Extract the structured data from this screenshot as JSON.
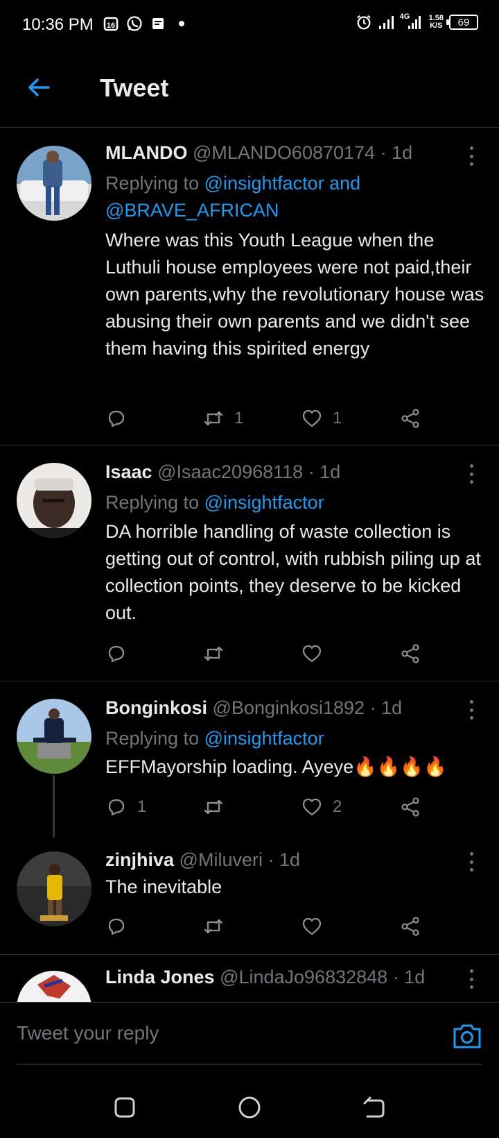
{
  "status_bar": {
    "time": "10:36 PM",
    "network_type": "4G",
    "net_speed_value": "1.58",
    "net_speed_unit": "K/S",
    "battery": "69",
    "left_icons": [
      "calendar-icon",
      "whatsapp-icon",
      "message-icon",
      "dot-icon"
    ],
    "right_icons": [
      "alarm-icon",
      "signal-icon",
      "signal-4g-icon"
    ]
  },
  "header": {
    "title": "Tweet"
  },
  "tweets": [
    {
      "name": "MLANDO",
      "handle": "@MLANDO60870174",
      "time": "· 1d",
      "replying_prefix": "Replying to",
      "replying_mentions": "@insightfactor and @BRAVE_AFRICAN",
      "text": "Where was this Youth League when the Luthuli house employees were not paid,their own parents,why the revolutionary house was abusing their own parents and we didn't see them having this spirited energy",
      "replies": "",
      "retweets": "1",
      "likes": "1"
    },
    {
      "name": "Isaac",
      "handle": "@Isaac20968118",
      "time": "· 1d",
      "replying_prefix": "Replying to",
      "replying_mentions": "@insightfactor",
      "text": "DA horrible handling of waste collection is getting out of control, with rubbish piling up at collection points, they deserve to be kicked out.",
      "replies": "",
      "retweets": "",
      "likes": ""
    },
    {
      "name": "Bonginkosi",
      "handle": "@Bonginkosi1892",
      "time": "· 1d",
      "replying_prefix": "Replying to",
      "replying_mentions": "@insightfactor",
      "text": "EFFMayorship loading. Ayeye🔥🔥🔥🔥",
      "replies": "1",
      "retweets": "",
      "likes": "2"
    },
    {
      "name": "zinjhiva",
      "handle": "@Miluveri",
      "time": "· 1d",
      "text": "The inevitable",
      "replies": "",
      "retweets": "",
      "likes": ""
    },
    {
      "name": "Linda Jones",
      "handle": "@LindaJo96832848",
      "time": "· 1d"
    }
  ],
  "reply_bar": {
    "placeholder": "Tweet your reply"
  },
  "colors": {
    "background": "#000000",
    "accent": "#1d9bf0",
    "secondary_text": "#71767b",
    "primary_text": "#e7e9ea",
    "divider": "#2f3336"
  }
}
